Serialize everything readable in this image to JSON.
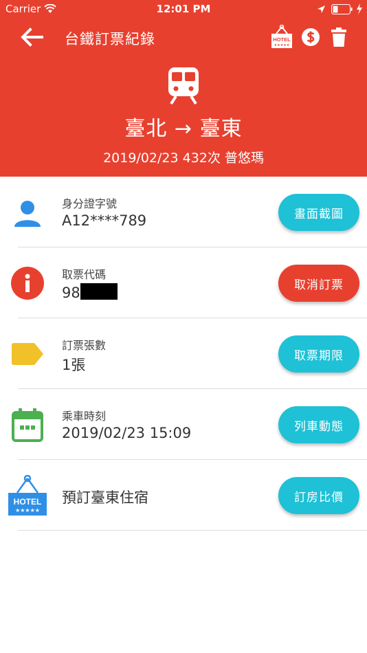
{
  "status_bar": {
    "carrier": "Carrier",
    "time": "12:01 PM"
  },
  "nav": {
    "title": "台鐵訂票紀錄",
    "hotel_icon_text": "HOTEL"
  },
  "trip": {
    "route": "臺北 → 臺東",
    "info": "2019/02/23 432次 普悠瑪"
  },
  "rows": [
    {
      "label": "身分證字號",
      "value": "A12****789",
      "button": "畫面截圖"
    },
    {
      "label": "取票代碼",
      "value": "98",
      "button": "取消訂票"
    },
    {
      "label": "訂票張數",
      "value": "1張",
      "button": "取票期限"
    },
    {
      "label": "乘車時刻",
      "value": "2019/02/23 15:09",
      "button": "列車動態"
    },
    {
      "value": "預訂臺東住宿",
      "button": "訂房比價",
      "hotel_icon_text": "HOTEL",
      "hotel_stars": "★★★★★"
    }
  ],
  "colors": {
    "header": "#e8402f",
    "cyan_button": "#1ec1d6",
    "red_button": "#e8402f",
    "person_icon": "#2f8fe6",
    "info_icon": "#e8402f",
    "tag_icon": "#f0c128",
    "calendar_icon": "#4caf50",
    "hotel_icon": "#2f8fe6"
  }
}
